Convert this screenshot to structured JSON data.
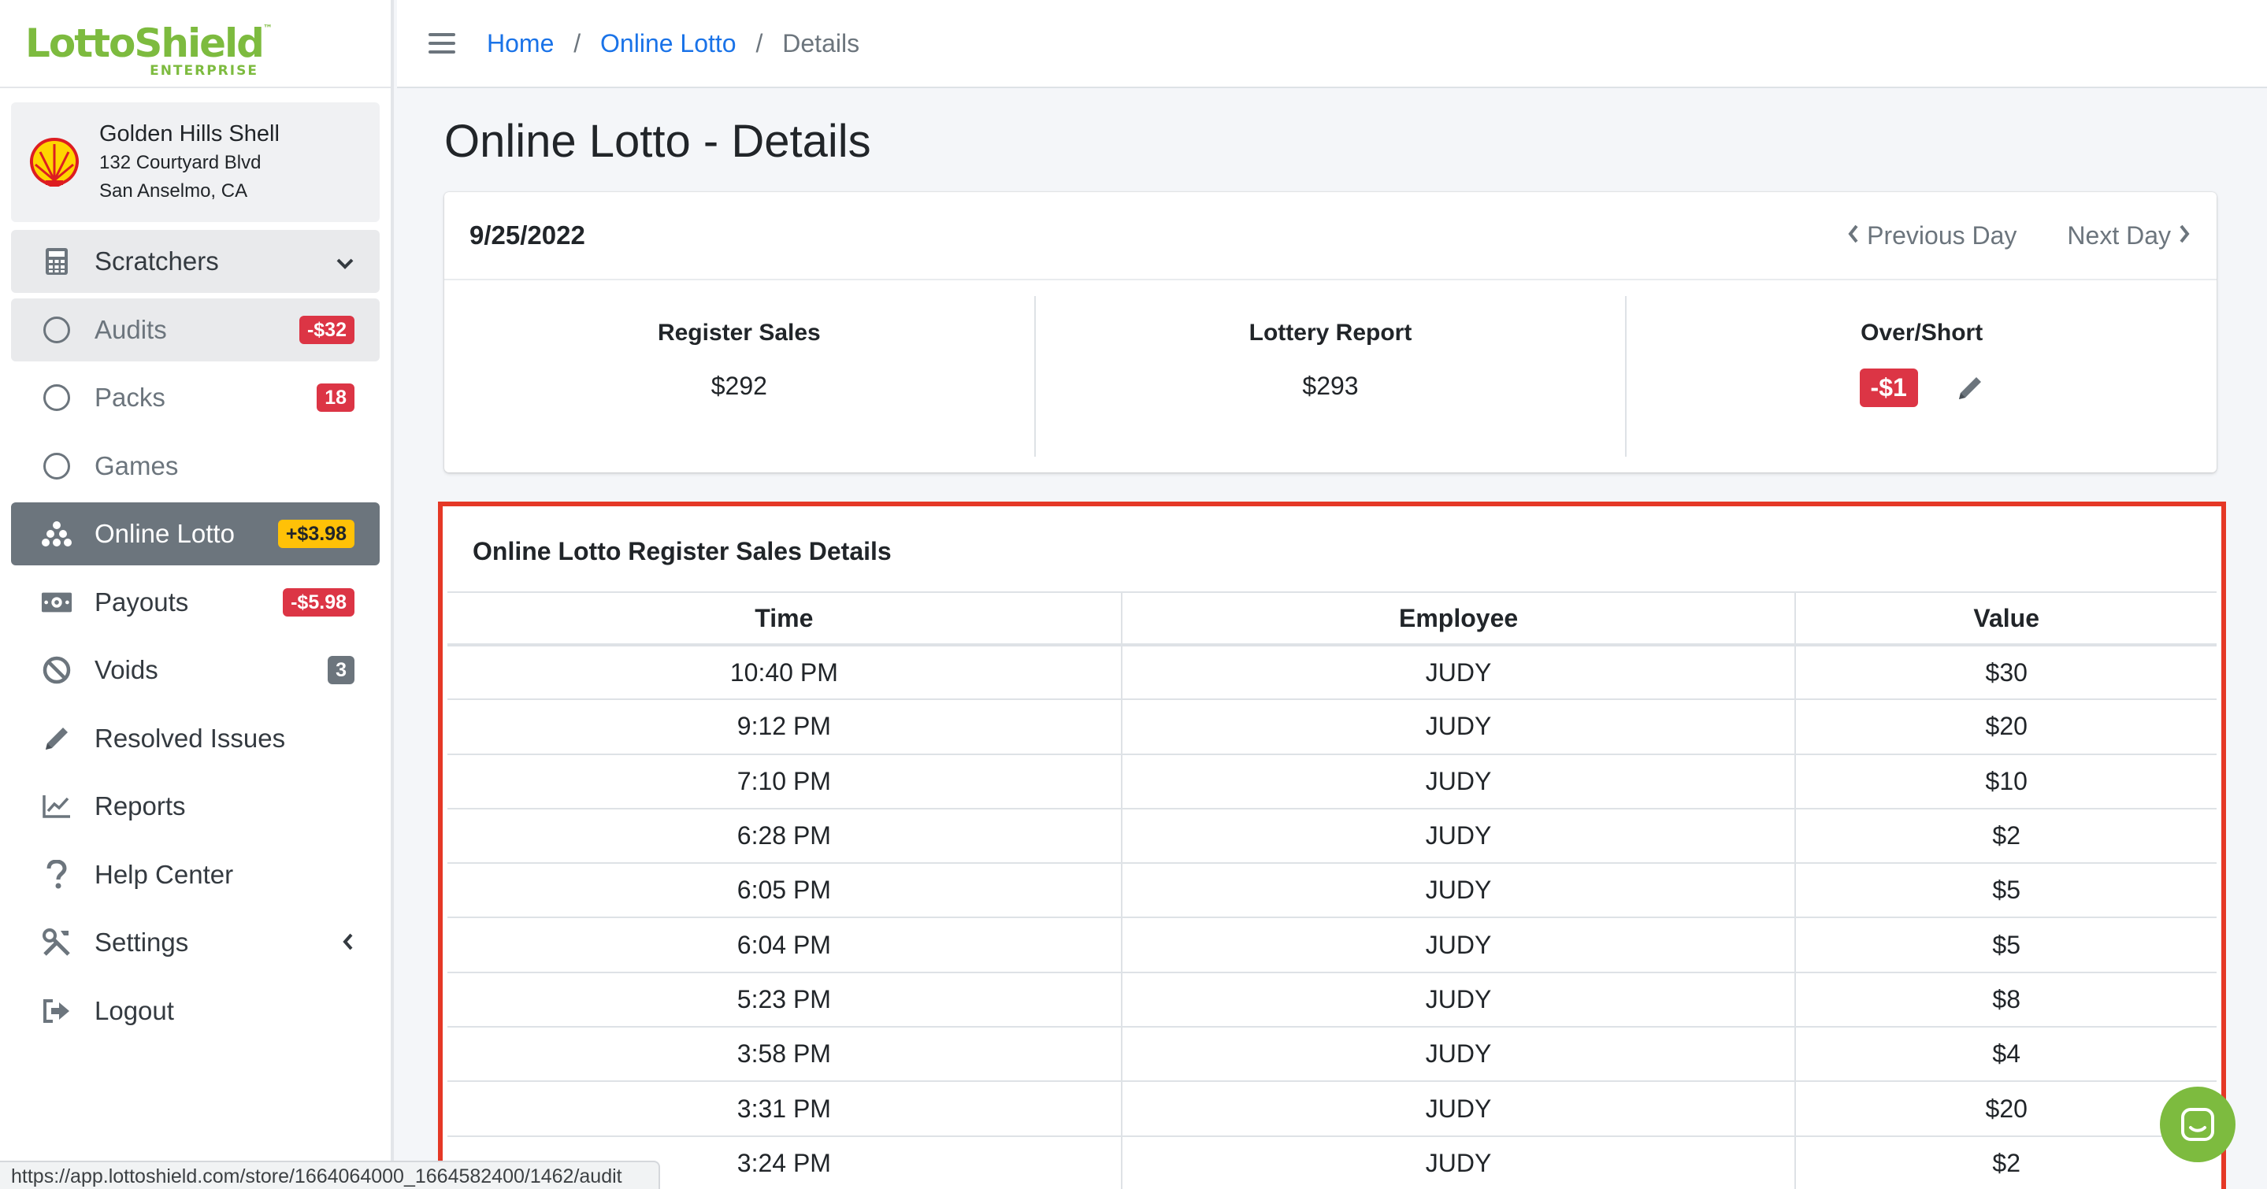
{
  "brand": {
    "logo_text": "LottoShield",
    "logo_tm": "™",
    "logo_sub": "ENTERPRISE",
    "color": "#7dbb3f"
  },
  "store": {
    "name": "Golden Hills Shell",
    "address_line1": "132 Courtyard Blvd",
    "address_line2": "San Anselmo, CA",
    "logo_icon": "shell-logo"
  },
  "sidebar": {
    "items": [
      {
        "label": "Scratchers",
        "icon": "calculator-icon",
        "trailing": "chevron-down-icon"
      },
      {
        "label": "Audits",
        "icon": "circle-icon",
        "badge": "-$32",
        "badge_color": "#dc3545"
      },
      {
        "label": "Packs",
        "icon": "circle-icon",
        "badge": "18",
        "badge_color": "#dc3545"
      },
      {
        "label": "Games",
        "icon": "circle-icon"
      },
      {
        "label": "Online Lotto",
        "icon": "lotto-balls-icon",
        "badge": "+$3.98",
        "badge_color": "#ffc107"
      },
      {
        "label": "Payouts",
        "icon": "money-bill-icon",
        "badge": "-$5.98",
        "badge_color": "#dc3545"
      },
      {
        "label": "Voids",
        "icon": "ban-icon",
        "badge": "3",
        "badge_color": "#6c757d"
      },
      {
        "label": "Resolved Issues",
        "icon": "pencil-icon"
      },
      {
        "label": "Reports",
        "icon": "chart-line-icon"
      },
      {
        "label": "Help Center",
        "icon": "question-icon"
      },
      {
        "label": "Settings",
        "icon": "tools-icon",
        "trailing": "chevron-left-icon"
      },
      {
        "label": "Logout",
        "icon": "sign-out-icon"
      }
    ]
  },
  "breadcrumb": {
    "home": "Home",
    "section": "Online Lotto",
    "current": "Details",
    "sep": "/"
  },
  "page": {
    "title": "Online Lotto - Details"
  },
  "summary": {
    "date": "9/25/2022",
    "prev_label": "Previous Day",
    "next_label": "Next Day",
    "register_sales_label": "Register Sales",
    "register_sales_value": "$292",
    "lottery_report_label": "Lottery Report",
    "lottery_report_value": "$293",
    "over_short_label": "Over/Short",
    "over_short_value": "-$1"
  },
  "details": {
    "title": "Online Lotto Register Sales Details",
    "columns": [
      "Time",
      "Employee",
      "Value"
    ],
    "rows": [
      [
        "10:40 PM",
        "JUDY",
        "$30"
      ],
      [
        "9:12 PM",
        "JUDY",
        "$20"
      ],
      [
        "7:10 PM",
        "JUDY",
        "$10"
      ],
      [
        "6:28 PM",
        "JUDY",
        "$2"
      ],
      [
        "6:05 PM",
        "JUDY",
        "$5"
      ],
      [
        "6:04 PM",
        "JUDY",
        "$5"
      ],
      [
        "5:23 PM",
        "JUDY",
        "$8"
      ],
      [
        "3:58 PM",
        "JUDY",
        "$4"
      ],
      [
        "3:31 PM",
        "JUDY",
        "$20"
      ],
      [
        "3:24 PM",
        "JUDY",
        "$2"
      ]
    ]
  },
  "status_url": "https://app.lottoshield.com/store/1664064000_1664582400/1462/audit",
  "highlight_color": "#e53826"
}
